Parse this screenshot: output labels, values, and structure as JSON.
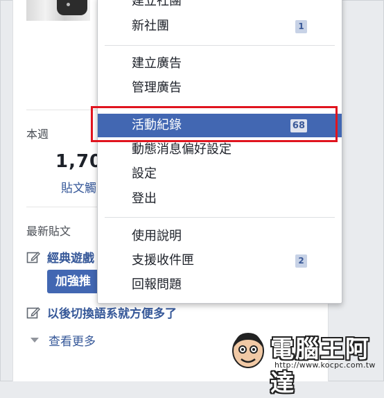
{
  "sidebar": {
    "week_label": "本週",
    "stat_value": "1,70",
    "stat_label": "貼文觸",
    "latest_label": "最新貼文",
    "posts": [
      "經典遊戲",
      "以後切換語系就方便多了"
    ],
    "boost_label": "加強推",
    "see_more": "查看更多"
  },
  "menu": {
    "items": [
      {
        "label": "建立社團"
      },
      {
        "label": "新社團",
        "badge": "1"
      },
      {
        "label": "建立廣告"
      },
      {
        "label": "管理廣告"
      },
      {
        "label": "活動紀錄",
        "badge": "68",
        "active": true
      },
      {
        "label": "動態消息偏好設定"
      },
      {
        "label": "設定"
      },
      {
        "label": "登出"
      },
      {
        "label": "使用說明"
      },
      {
        "label": "支援收件匣",
        "badge": "2"
      },
      {
        "label": "回報問題"
      }
    ]
  },
  "watermark": {
    "brand": "電腦王阿達",
    "url": "http://www.kocpc.com.tw"
  },
  "colors": {
    "accent": "#4267b2",
    "link": "#365899",
    "highlight_box": "#e0141e",
    "badge_bg": "#c7d2e6"
  }
}
